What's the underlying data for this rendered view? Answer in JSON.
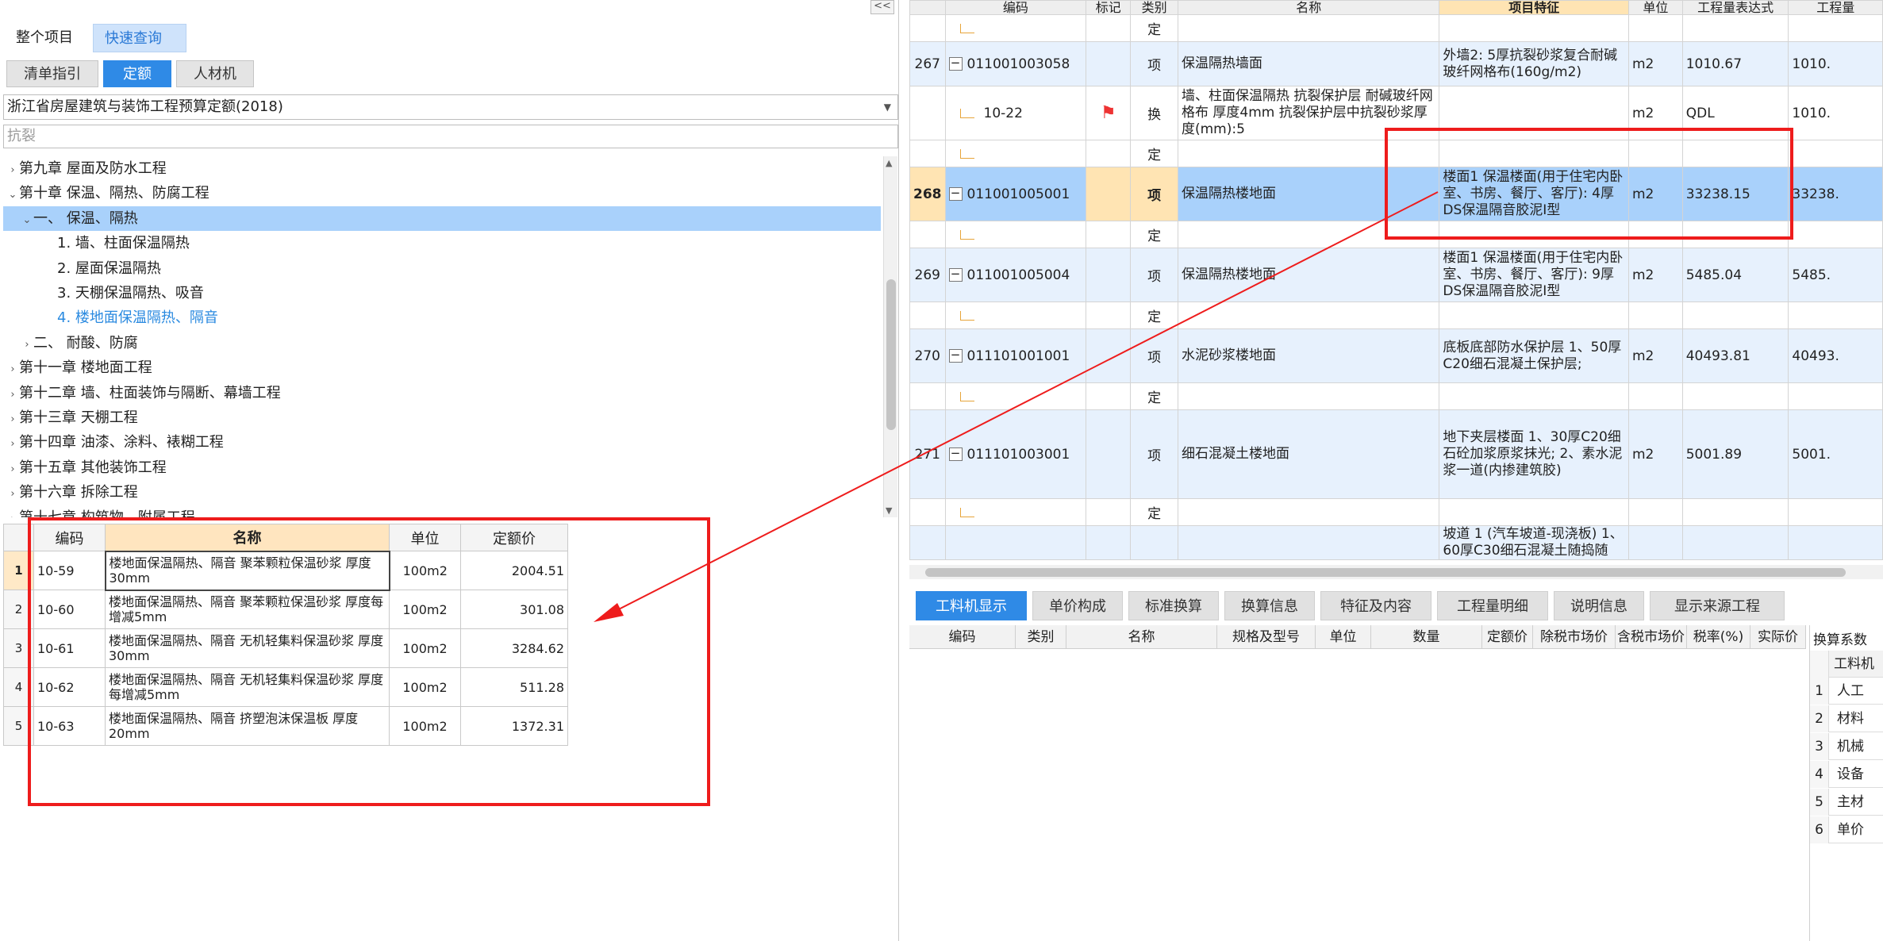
{
  "left": {
    "collapse": "<<",
    "top_tabs": [
      "整个项目",
      "快速查询"
    ],
    "sub_tabs": [
      "清单指引",
      "定额",
      "人材机"
    ],
    "quota_select": "浙江省房屋建筑与装饰工程预算定额(2018)",
    "search_placeholder": "抗裂",
    "tree": [
      {
        "chev": ">",
        "text": "第九章 屋面及防水工程"
      },
      {
        "chev": "v",
        "text": "第十章 保温、隔热、防腐工程"
      },
      {
        "chev": "v",
        "text": "一、 保温、隔热"
      },
      {
        "chev": "",
        "text": "1. 墙、柱面保温隔热"
      },
      {
        "chev": "",
        "text": "2. 屋面保温隔热"
      },
      {
        "chev": "",
        "text": "3. 天棚保温隔热、吸音"
      },
      {
        "chev": "",
        "text": "4. 楼地面保温隔热、隔音"
      },
      {
        "chev": ">",
        "text": "二、 耐酸、防腐"
      },
      {
        "chev": ">",
        "text": "第十一章 楼地面工程"
      },
      {
        "chev": ">",
        "text": "第十二章 墙、柱面装饰与隔断、幕墙工程"
      },
      {
        "chev": ">",
        "text": "第十三章 天棚工程"
      },
      {
        "chev": ">",
        "text": "第十四章 油漆、涂料、裱糊工程"
      },
      {
        "chev": ">",
        "text": "第十五章 其他装饰工程"
      },
      {
        "chev": ">",
        "text": "第十六章 拆除工程"
      },
      {
        "chev": ">",
        "text": "第十七章 构筑物、附属工程"
      }
    ],
    "table_headers": [
      "编码",
      "名称",
      "单位",
      "定额价"
    ],
    "rows": [
      {
        "n": "1",
        "code": "10-59",
        "name": "楼地面保温隔热、隔音 聚苯颗粒保温砂浆 厚度30mm",
        "unit": "100m2",
        "price": "2004.51"
      },
      {
        "n": "2",
        "code": "10-60",
        "name": "楼地面保温隔热、隔音 聚苯颗粒保温砂浆 厚度每增减5mm",
        "unit": "100m2",
        "price": "301.08"
      },
      {
        "n": "3",
        "code": "10-61",
        "name": "楼地面保温隔热、隔音 无机轻集料保温砂浆 厚度30mm",
        "unit": "100m2",
        "price": "3284.62"
      },
      {
        "n": "4",
        "code": "10-62",
        "name": "楼地面保温隔热、隔音 无机轻集料保温砂浆 厚度每增减5mm",
        "unit": "100m2",
        "price": "511.28"
      },
      {
        "n": "5",
        "code": "10-63",
        "name": "楼地面保温隔热、隔音 挤塑泡沫保温板 厚度20mm",
        "unit": "100m2",
        "price": "1372.31"
      }
    ]
  },
  "grid": {
    "headers": [
      "",
      "编码",
      "标记",
      "类别",
      "名称",
      "项目特征",
      "单位",
      "工程量表达式",
      "工程量"
    ],
    "rows": [
      {
        "kind": "def",
        "rn": "",
        "code": "",
        "mark": "",
        "cat": "定",
        "name": "",
        "feat": "",
        "unit": "",
        "expr": "",
        "qty": ""
      },
      {
        "kind": "qd",
        "rn": "267",
        "code": "011001003058",
        "mark": "",
        "cat": "项",
        "name": "保温隔热墙面",
        "feat": "外墙2: 5厚抗裂砂浆复合耐碱玻纤网格布(160g/m2)",
        "unit": "m2",
        "expr": "1010.67",
        "qty": "1010."
      },
      {
        "kind": "sub",
        "rn": "",
        "code": "10-22",
        "mark": "flag",
        "cat": "换",
        "name": "墙、柱面保温隔热 抗裂保护层 耐碱玻纤网格布 厚度4mm 抗裂保护层中抗裂砂浆厚度(mm):5",
        "feat": "",
        "unit": "m2",
        "expr": "QDL",
        "qty": "1010."
      },
      {
        "kind": "def",
        "rn": "",
        "code": "",
        "mark": "",
        "cat": "定",
        "name": "",
        "feat": "",
        "unit": "",
        "expr": "",
        "qty": ""
      },
      {
        "kind": "sel",
        "rn": "268",
        "code": "011001005001",
        "mark": "",
        "cat": "项",
        "name": "保温隔热楼地面",
        "feat": "楼面1 保温楼面(用于住宅内卧室、书房、餐厅、客厅): 4厚DS保温隔音胶泥Ⅰ型",
        "unit": "m2",
        "expr": "33238.15",
        "qty": "33238."
      },
      {
        "kind": "def",
        "rn": "",
        "code": "",
        "mark": "",
        "cat": "定",
        "name": "",
        "feat": "",
        "unit": "",
        "expr": "",
        "qty": ""
      },
      {
        "kind": "qd",
        "rn": "269",
        "code": "011001005004",
        "mark": "",
        "cat": "项",
        "name": "保温隔热楼地面",
        "feat": "楼面1 保温楼面(用于住宅内卧室、书房、餐厅、客厅): 9厚DS保温隔音胶泥Ⅰ型",
        "unit": "m2",
        "expr": "5485.04",
        "qty": "5485."
      },
      {
        "kind": "def",
        "rn": "",
        "code": "",
        "mark": "",
        "cat": "定",
        "name": "",
        "feat": "",
        "unit": "",
        "expr": "",
        "qty": ""
      },
      {
        "kind": "qd",
        "rn": "270",
        "code": "011101001001",
        "mark": "",
        "cat": "项",
        "name": "水泥砂浆楼地面",
        "feat": "底板底部防水保护层 1、50厚C20细石混凝土保护层;",
        "unit": "m2",
        "expr": "40493.81",
        "qty": "40493."
      },
      {
        "kind": "def",
        "rn": "",
        "code": "",
        "mark": "",
        "cat": "定",
        "name": "",
        "feat": "",
        "unit": "",
        "expr": "",
        "qty": ""
      },
      {
        "kind": "qd",
        "rn": "271",
        "code": "011101003001",
        "mark": "",
        "cat": "项",
        "name": "细石混凝土楼地面",
        "feat": "地下夹层楼面 1、30厚C20细石砼加浆原浆抹光; 2、素水泥浆一道(内掺建筑胶)",
        "unit": "m2",
        "expr": "5001.89",
        "qty": "5001."
      },
      {
        "kind": "def",
        "rn": "",
        "code": "",
        "mark": "",
        "cat": "定",
        "name": "",
        "feat": "",
        "unit": "",
        "expr": "",
        "qty": ""
      },
      {
        "kind": "qd",
        "rn": "",
        "code": "",
        "mark": "",
        "cat": "",
        "name": "",
        "feat": "坡道 1 (汽车坡道-现浇板) 1、60厚C30细石混凝土随捣随",
        "unit": "",
        "expr": "",
        "qty": ""
      }
    ]
  },
  "bottom_tabs": [
    "工料机显示",
    "单价构成",
    "标准换算",
    "换算信息",
    "特征及内容",
    "工程量明细",
    "说明信息",
    "显示来源工程"
  ],
  "sub_headers": [
    "编码",
    "类别",
    "名称",
    "规格及型号",
    "单位",
    "数量",
    "定额价",
    "除税市场价",
    "含税市场价",
    "税率(%)",
    "实际价"
  ],
  "side_panel": {
    "title": "换算系数",
    "header": "工料机",
    "rows": [
      {
        "n": "1",
        "t": "人工"
      },
      {
        "n": "2",
        "t": "材料"
      },
      {
        "n": "3",
        "t": "机械"
      },
      {
        "n": "4",
        "t": "设备"
      },
      {
        "n": "5",
        "t": "主材"
      },
      {
        "n": "6",
        "t": "单价"
      }
    ]
  },
  "colors": {
    "accent": "#2f8ae6",
    "selected_row": "#a9d1fb",
    "header_highlight": "#ffe4b3",
    "annotation": "#ee1c1c"
  }
}
